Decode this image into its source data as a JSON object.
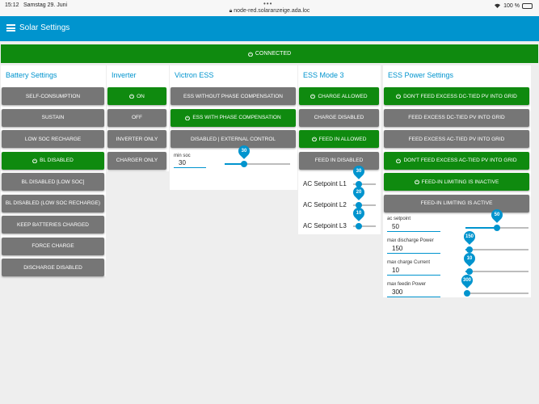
{
  "statusbar": {
    "time": "15:12",
    "date": "Samstag 29. Juni",
    "url": "node-red.solaranzeige.ada.loc",
    "battery": "100 %"
  },
  "header": {
    "title": "Solar Settings"
  },
  "connection": {
    "label": "CONNECTED"
  },
  "battery_settings": {
    "title": "Battery Settings",
    "buttons": [
      {
        "label": "SELF-CONSUMPTION",
        "active": false
      },
      {
        "label": "SUSTAIN",
        "active": false
      },
      {
        "label": "LOW SOC RECHARGE",
        "active": false
      },
      {
        "label": "BL DISABLED",
        "active": true
      },
      {
        "label": "BL DISABLED [LOW SOC]",
        "active": false
      },
      {
        "label": "BL DISABLED (LOW SOC RECHARGE)",
        "active": false
      },
      {
        "label": "KEEP BATTERIES CHARGED",
        "active": false
      },
      {
        "label": "FORCE CHARGE",
        "active": false
      },
      {
        "label": "DISCHARGE DISABLED",
        "active": false
      }
    ]
  },
  "inverter": {
    "title": "Inverter",
    "buttons": [
      {
        "label": "ON",
        "active": true
      },
      {
        "label": "OFF",
        "active": false
      },
      {
        "label": "INVERTER ONLY",
        "active": false
      },
      {
        "label": "CHARGER ONLY",
        "active": false
      }
    ]
  },
  "victron_ess": {
    "title": "Victron ESS",
    "buttons": [
      {
        "label": "ESS WITHOUT PHASE COMPENSATION",
        "active": false
      },
      {
        "label": "ESS WITH PHASE COMPENSATION",
        "active": true
      },
      {
        "label": "DISABLED | EXTERNAL CONTROL",
        "active": false
      }
    ],
    "min_soc": {
      "label": "min soc",
      "value": "30",
      "pin": "30",
      "fraction": 0.3
    }
  },
  "ess_mode3": {
    "title": "ESS Mode 3",
    "buttons": [
      {
        "label": "CHARGE ALLOWED",
        "active": true
      },
      {
        "label": "CHARGE DISABLED",
        "active": false
      },
      {
        "label": "FEED IN ALLOWED",
        "active": true
      },
      {
        "label": "FEED IN DISABLED",
        "active": false
      }
    ],
    "setpoints": [
      {
        "label": "AC Setpoint L1",
        "pin": "30"
      },
      {
        "label": "AC Setpoint L2",
        "pin": "20"
      },
      {
        "label": "AC Setpoint L3",
        "pin": "10"
      }
    ]
  },
  "ess_power": {
    "title": "ESS Power Settings",
    "buttons": [
      {
        "label": "DON'T FEED EXCESS DC-TIED PV INTO GRID",
        "active": true
      },
      {
        "label": "FEED EXCESS DC-TIED PV INTO GRID",
        "active": false
      },
      {
        "label": "FEED EXCESS AC-TIED PV INTO GRID",
        "active": false
      },
      {
        "label": "DON'T FEED EXCESS AC-TIED PV INTO GRID",
        "active": true
      },
      {
        "label": "FEED-IN LIMITING IS INACTIVE",
        "active": true
      },
      {
        "label": "FEED-IN LIMITING IS ACTIVE",
        "active": false
      }
    ],
    "sliders": [
      {
        "label": "ac setpoint",
        "value": "50",
        "pin": "50",
        "fraction": 0.5
      },
      {
        "label": "max discharge Power",
        "value": "150",
        "pin": "150",
        "fraction": 0.06
      },
      {
        "label": "max charge Current",
        "value": "10",
        "pin": "10",
        "fraction": 0.06
      },
      {
        "label": "max feedin Power",
        "value": "300",
        "pin": "300",
        "fraction": 0.03
      }
    ]
  },
  "colors": {
    "accent": "#0094ce",
    "active": "#0f8a0f",
    "inactive": "#767676"
  }
}
